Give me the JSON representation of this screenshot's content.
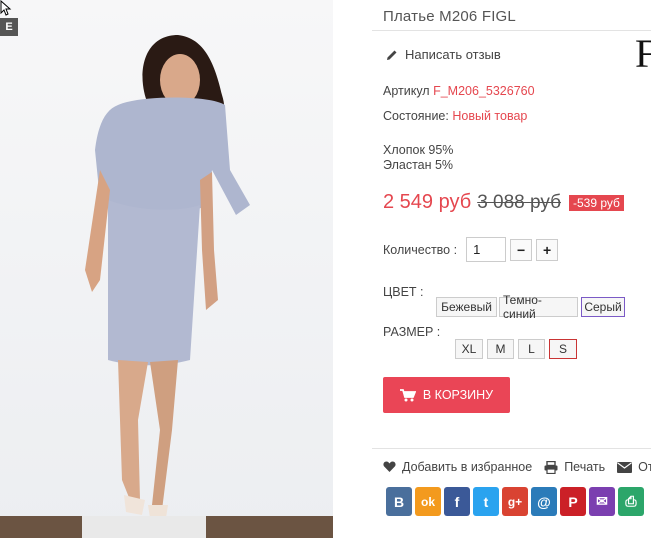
{
  "product": {
    "title": "Платье M206 FIGL",
    "brand_logo_text": "F",
    "badge": "E",
    "review_link": "Написать отзыв",
    "sku_label": "Артикул",
    "sku_value": "F_M206_5326760",
    "condition_label": "Состояние:",
    "condition_value": "Новый товар",
    "composition": [
      "Хлопок 95%",
      "Эластан 5%"
    ],
    "price": "2 549 руб",
    "old_price": "3 088 руб",
    "discount": "-539 руб",
    "quantity_label": "Количество :",
    "quantity_value": "1",
    "minus_label": "−",
    "plus_label": "+"
  },
  "options": {
    "color_label": "ЦВЕТ :",
    "colors": [
      "Бежевый",
      "Темно-синий",
      "Серый"
    ],
    "selected_color": "Серый",
    "size_label": "РАЗМЕР :",
    "sizes": [
      "XL",
      "M",
      "L",
      "S"
    ],
    "selected_size": "S"
  },
  "cart_button": {
    "label": "В КОРЗИНУ",
    "icon": "cart-icon"
  },
  "actions": {
    "favorite": "Добавить в избранное",
    "print": "Печать",
    "send": "От"
  },
  "social": [
    {
      "name": "vk",
      "glyph": "В",
      "color": "#4a6f9c"
    },
    {
      "name": "odnoklassniki",
      "glyph": "ok",
      "color": "#f39a1e"
    },
    {
      "name": "facebook",
      "glyph": "f",
      "color": "#3b5998"
    },
    {
      "name": "twitter",
      "glyph": "t",
      "color": "#2aa3ef"
    },
    {
      "name": "google-plus",
      "glyph": "g+",
      "color": "#d94332"
    },
    {
      "name": "email",
      "glyph": "@",
      "color": "#2b7bb9"
    },
    {
      "name": "pinterest",
      "glyph": "P",
      "color": "#cb2027"
    },
    {
      "name": "mail",
      "glyph": "✉",
      "color": "#7b3fb0"
    },
    {
      "name": "print",
      "glyph": "⎙",
      "color": "#2ca66a"
    }
  ],
  "colors": {
    "accent": "#e5474f",
    "cart": "#ea4556"
  }
}
